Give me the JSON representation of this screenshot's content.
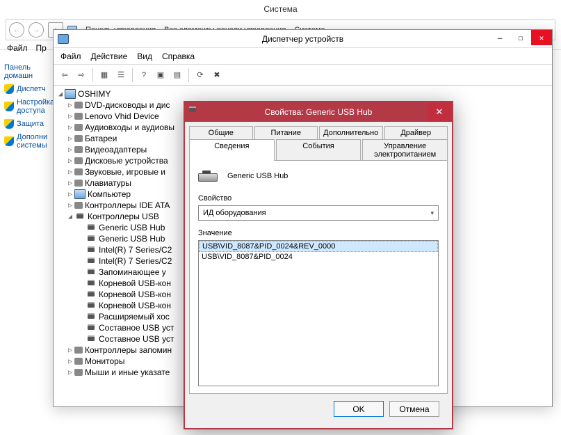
{
  "bg": {
    "title": "Система",
    "breadcrumbs": [
      "Панель управления",
      "Все элементы панели управления",
      "Система"
    ],
    "menu": [
      "Файл",
      "Пр"
    ],
    "sidebar": [
      {
        "label": "Панель домашн",
        "shield": false
      },
      {
        "label": "Диспетч",
        "shield": true
      },
      {
        "label": "Настройка доступа",
        "shield": true
      },
      {
        "label": "Защита",
        "shield": true
      },
      {
        "label": "Дополни системы",
        "shield": true
      }
    ]
  },
  "devmgr": {
    "title": "Диспетчер устройств",
    "menu": [
      "Файл",
      "Действие",
      "Вид",
      "Справка"
    ],
    "tree": [
      {
        "indent": 0,
        "expander": "◢",
        "icon": "pc",
        "label": "OSHIMY"
      },
      {
        "indent": 1,
        "expander": "▷",
        "icon": "gen",
        "label": "DVD-дисководы и дис"
      },
      {
        "indent": 1,
        "expander": "▷",
        "icon": "gen",
        "label": "Lenovo Vhid Device"
      },
      {
        "indent": 1,
        "expander": "▷",
        "icon": "gen",
        "label": "Аудиовходы и аудиовы"
      },
      {
        "indent": 1,
        "expander": "▷",
        "icon": "gen",
        "label": "Батареи"
      },
      {
        "indent": 1,
        "expander": "▷",
        "icon": "gen",
        "label": "Видеоадаптеры"
      },
      {
        "indent": 1,
        "expander": "▷",
        "icon": "gen",
        "label": "Дисковые устройства"
      },
      {
        "indent": 1,
        "expander": "▷",
        "icon": "gen",
        "label": "Звуковые, игровые и"
      },
      {
        "indent": 1,
        "expander": "▷",
        "icon": "gen",
        "label": "Клавиатуры"
      },
      {
        "indent": 1,
        "expander": "▷",
        "icon": "pc",
        "label": "Компьютер"
      },
      {
        "indent": 1,
        "expander": "▷",
        "icon": "gen",
        "label": "Контроллеры IDE ATA"
      },
      {
        "indent": 1,
        "expander": "◢",
        "icon": "usb",
        "label": "Контроллеры USB"
      },
      {
        "indent": 2,
        "expander": "",
        "icon": "usb",
        "label": "Generic USB Hub"
      },
      {
        "indent": 2,
        "expander": "",
        "icon": "usb",
        "label": "Generic USB Hub"
      },
      {
        "indent": 2,
        "expander": "",
        "icon": "usb",
        "label": "Intel(R) 7 Series/C2"
      },
      {
        "indent": 2,
        "expander": "",
        "icon": "usb",
        "label": "Intel(R) 7 Series/C2"
      },
      {
        "indent": 2,
        "expander": "",
        "icon": "usb",
        "label": "Запоминающее у"
      },
      {
        "indent": 2,
        "expander": "",
        "icon": "usb",
        "label": "Корневой USB-кон"
      },
      {
        "indent": 2,
        "expander": "",
        "icon": "usb",
        "label": "Корневой USB-кон"
      },
      {
        "indent": 2,
        "expander": "",
        "icon": "usb",
        "label": "Корневой USB-кон"
      },
      {
        "indent": 2,
        "expander": "",
        "icon": "usb",
        "label": "Расширяемый хос"
      },
      {
        "indent": 2,
        "expander": "",
        "icon": "usb",
        "label": "Составное USB уст"
      },
      {
        "indent": 2,
        "expander": "",
        "icon": "usb",
        "label": "Составное USB уст"
      },
      {
        "indent": 1,
        "expander": "▷",
        "icon": "gen",
        "label": "Контроллеры запомин"
      },
      {
        "indent": 1,
        "expander": "▷",
        "icon": "gen",
        "label": "Мониторы"
      },
      {
        "indent": 1,
        "expander": "▷",
        "icon": "gen",
        "label": "Мыши и иные указате"
      }
    ]
  },
  "props": {
    "title": "Свойства: Generic USB Hub",
    "tabs_row1": [
      "Общие",
      "Питание",
      "Дополнительно",
      "Драйвер"
    ],
    "tabs_row2": [
      "Сведения",
      "События",
      "Управление электропитанием"
    ],
    "active_tab": "Сведения",
    "device_name": "Generic USB Hub",
    "property_label": "Свойство",
    "property_selected": "ИД оборудования",
    "value_label": "Значение",
    "values": [
      "USB\\VID_8087&PID_0024&REV_0000",
      "USB\\VID_8087&PID_0024"
    ],
    "ok": "OK",
    "cancel": "Отмена"
  }
}
